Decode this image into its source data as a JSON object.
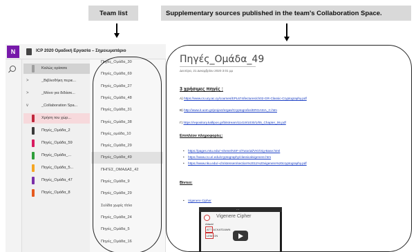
{
  "annotations": {
    "team_list": "Team list",
    "supplementary": "Supplementary sources published in the team's Collaboration Space."
  },
  "app": {
    "logo": "N",
    "notebook_title": "ICP 2020 Ομαδική Εργασία – Σημειωματάριο"
  },
  "sections": [
    {
      "label": "Καλώς ορίσατε",
      "expander": "",
      "color": "#9e9e9e"
    },
    {
      "label": "_Βιβλιοθήκη περιε...",
      "expander": ">",
      "color": ""
    },
    {
      "label": "_Μόνο για διδάσκ...",
      "expander": ">",
      "color": ""
    },
    {
      "label": "_Collaboration Spa...",
      "expander": "v",
      "color": ""
    },
    {
      "label": "Χρήση του χώρ...",
      "expander": "",
      "color": "#c0283d"
    },
    {
      "label": "Πηγές_Ομάδα_2",
      "expander": "",
      "color": "#3a3a3a"
    },
    {
      "label": "Πηγές_Ομάδα_59",
      "expander": "",
      "color": "#d81b60"
    },
    {
      "label": "Πηγές_Ομάδα_...",
      "expander": "",
      "color": "#2e9e3a"
    },
    {
      "label": "Πηγές_Ομάδα_5...",
      "expander": "",
      "color": "#f5a623"
    },
    {
      "label": "Πηγές_Ομάδα_47",
      "expander": "",
      "color": "#7b2fa8"
    },
    {
      "label": "Πηγές_Ομάδα_8",
      "expander": "",
      "color": "#e55a1f"
    }
  ],
  "pages": [
    "Πηγές_Ομάδα_30",
    "Πηγές_Ομάδα_69",
    "Πηγές_Ομάδα_27",
    "Πηγές_Ομάδα_48",
    "Πηγές_Ομάδα_31",
    "Πηγές_Ομάδα_38",
    "Πηγές_ομάδα_10",
    "Πηγές_Ομάδα_29",
    "Πηγές_Ομάδα_49",
    "ΠΗΓΕΣ_ΟΜΑΔΑΣ_42",
    "Πηγές_Ομάδα_9",
    "Πηγές_Ομάδα_29",
    "Σελίδα χωρίς τίτλο",
    "Πηγές_Ομάδα_24",
    "Πηγές_Ομάδα_5",
    "Πηγές_Ομάδα_16"
  ],
  "content": {
    "title": "Πηγές_Ομάδα_49",
    "date": "Δευτέρα, 21 Δεκεμβρίου 2020    3:01 μμ",
    "useful_heading": "3 χρήσιμες πηγές :",
    "useful_links": [
      {
        "prefix": "A) ",
        "url": "https://www.cs.ucy.ac.cy/courses/EPL674/lectures/ch02-GR-Classic-Cryptography.pdf"
      },
      {
        "prefix": "B) ",
        "url": "http://www.it.uom.gr/project/ergas/Cryptografos/ERGASIA_C.htm"
      },
      {
        "prefix": "Γ) ",
        "url": "https://repository.kallipos.gr/bitstream/11419/1030/1/05_Chapter_06.pdf"
      }
    ],
    "extra_heading": "Επιπλέον πληροφορίες:",
    "extra_links": [
      "https://pages.mtu.edu/~shene/NSF-4/Tutorial/VIG/Vig-Base.html",
      "https://www.cs.uri.edu/cryptography/classicalvigenere.htm",
      "https://www.nku.edu/~christensen/section%2011%20vigenere%20cryptography.pdf"
    ],
    "video_heading": "Βίντεο:",
    "video_link": "Vigenere Cipher",
    "video": {
      "more": "...",
      "title": "Vigenere Cipher",
      "line1": "Attack!",
      "line2": "ATT",
      "line2b": "ACKATDAWN",
      "line3": "LEM",
      "line3b": "ON"
    }
  }
}
